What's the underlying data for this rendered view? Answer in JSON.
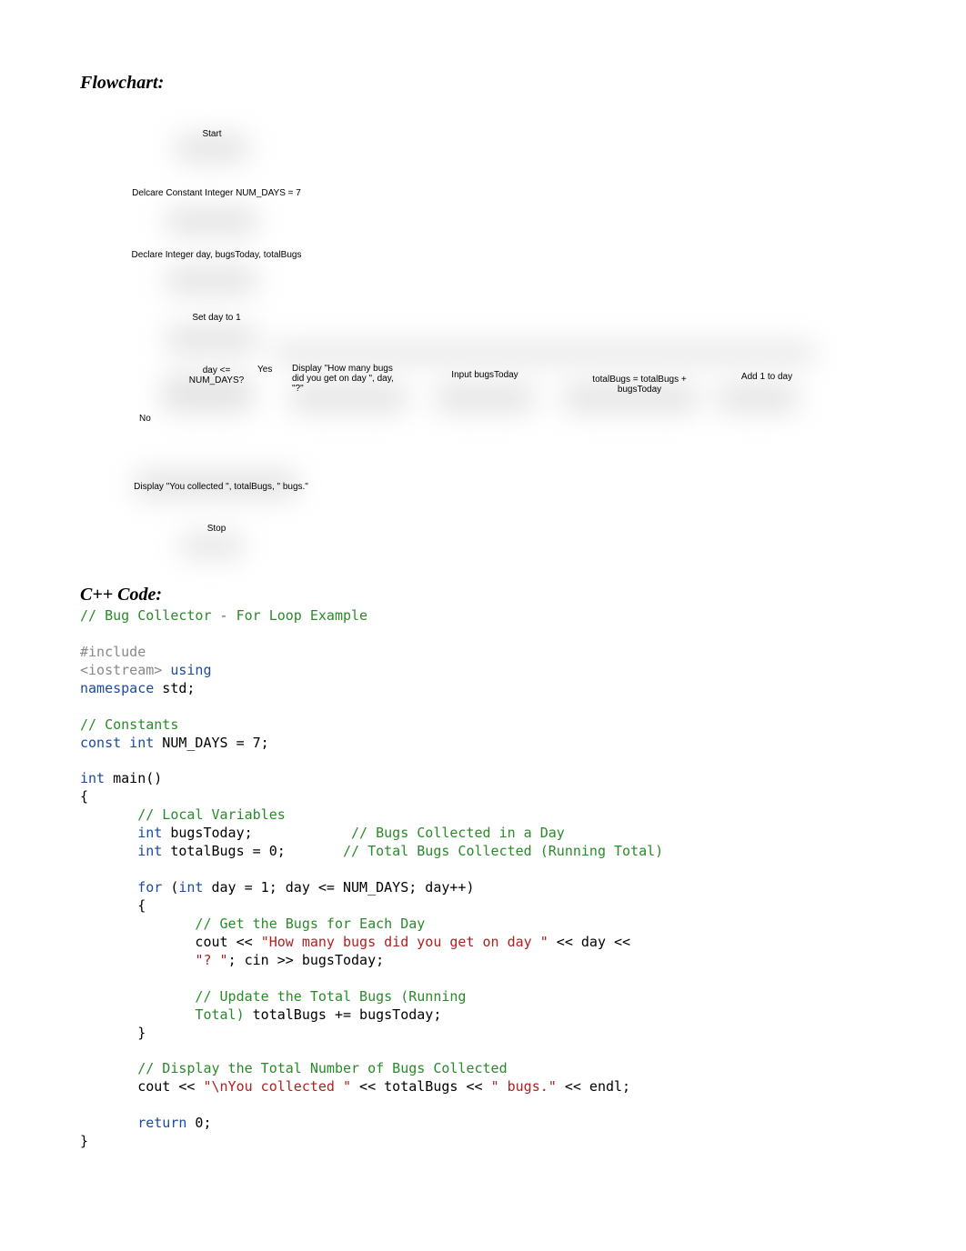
{
  "headings": {
    "flowchart": "Flowchart:",
    "cpp_code": "C++ Code:"
  },
  "flowchart": {
    "start": "Start",
    "declare_const": "Delcare Constant Integer NUM_DAYS = 7",
    "declare_vars": "Declare Integer day, bugsToday, totalBugs",
    "set_day": "Set day to 1",
    "decision": "day <= NUM_DAYS?",
    "yes": "Yes",
    "no": "No",
    "display_prompt": "Display \"How many bugs did you get on day \", day, \"?\"",
    "input": "Input bugsToday",
    "update_total": "totalBugs = totalBugs + bugsToday",
    "increment": "Add 1 to day",
    "display_result": "Display \"You collected \", totalBugs, \" bugs.\"",
    "stop": "Stop"
  },
  "code": {
    "l01": "// Bug Collector - For Loop Example",
    "l02": "#include",
    "l03a": "<iostream>",
    "l03b": " using",
    "l04a": "namespace",
    "l04b": " std;",
    "l05": "// Constants",
    "l06a": "const",
    "l06b": " int",
    "l06c": " NUM_DAYS = 7;",
    "l07a": "int",
    "l07b": " main()",
    "l08": "{",
    "l09": "       // Local Variables",
    "l10a": "       int",
    "l10b": " bugsToday;            ",
    "l10c": "// Bugs Collected in a Day",
    "l11a": "       int",
    "l11b": " totalBugs = 0;       ",
    "l11c": "// Total Bugs Collected (Running Total)",
    "l12a": "       for",
    "l12b": " (",
    "l12c": "int",
    "l12d": " day = 1; day <= NUM_DAYS; day++)",
    "l13": "       {",
    "l14": "              // Get the Bugs for Each Day",
    "l15a": "              cout << ",
    "l15b": "\"How many bugs did you get on day \"",
    "l15c": " << day <<",
    "l16a": "              ",
    "l16b": "\"? \"",
    "l16c": "; cin >> bugsToday;",
    "l17": "              // Update the Total Bugs (Running",
    "l18a": "              Total)",
    "l18b": " totalBugs += bugsToday;",
    "l19": "       }",
    "l20": "       // Display the Total Number of Bugs Collected",
    "l21a": "       cout << ",
    "l21b": "\"\\nYou collected \"",
    "l21c": " << totalBugs << ",
    "l21d": "\" bugs.\"",
    "l21e": " << endl;",
    "l22a": "       return",
    "l22b": " 0;",
    "l23": "}"
  }
}
